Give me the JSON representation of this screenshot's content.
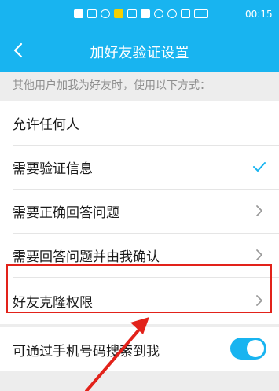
{
  "status_bar": {
    "time": "00:15",
    "icons": [
      "sim-icon",
      "signal-icon",
      "wifi-icon",
      "hd-icon",
      "app-icon",
      "app-icon",
      "nfc-icon",
      "alarm-icon",
      "vibrate-icon",
      "battery-icon"
    ]
  },
  "header": {
    "title": "加好友验证设置",
    "back_icon": "chevron-left-icon"
  },
  "section_hint": "其他用户加我为好友时，使用以下方式：",
  "options": [
    {
      "label": "允许任何人",
      "indicator": "none"
    },
    {
      "label": "需要验证信息",
      "indicator": "checkmark-icon"
    },
    {
      "label": "需要正确回答问题",
      "indicator": "chevron-right-icon"
    },
    {
      "label": "需要回答问题并由我确认",
      "indicator": "chevron-right-icon"
    },
    {
      "label": "好友克隆权限",
      "indicator": "chevron-right-icon"
    }
  ],
  "phone_search": {
    "label": "可通过手机号码搜索到我",
    "enabled": true
  },
  "colors": {
    "accent": "#18b4f0",
    "annotation": "#e2221a"
  }
}
